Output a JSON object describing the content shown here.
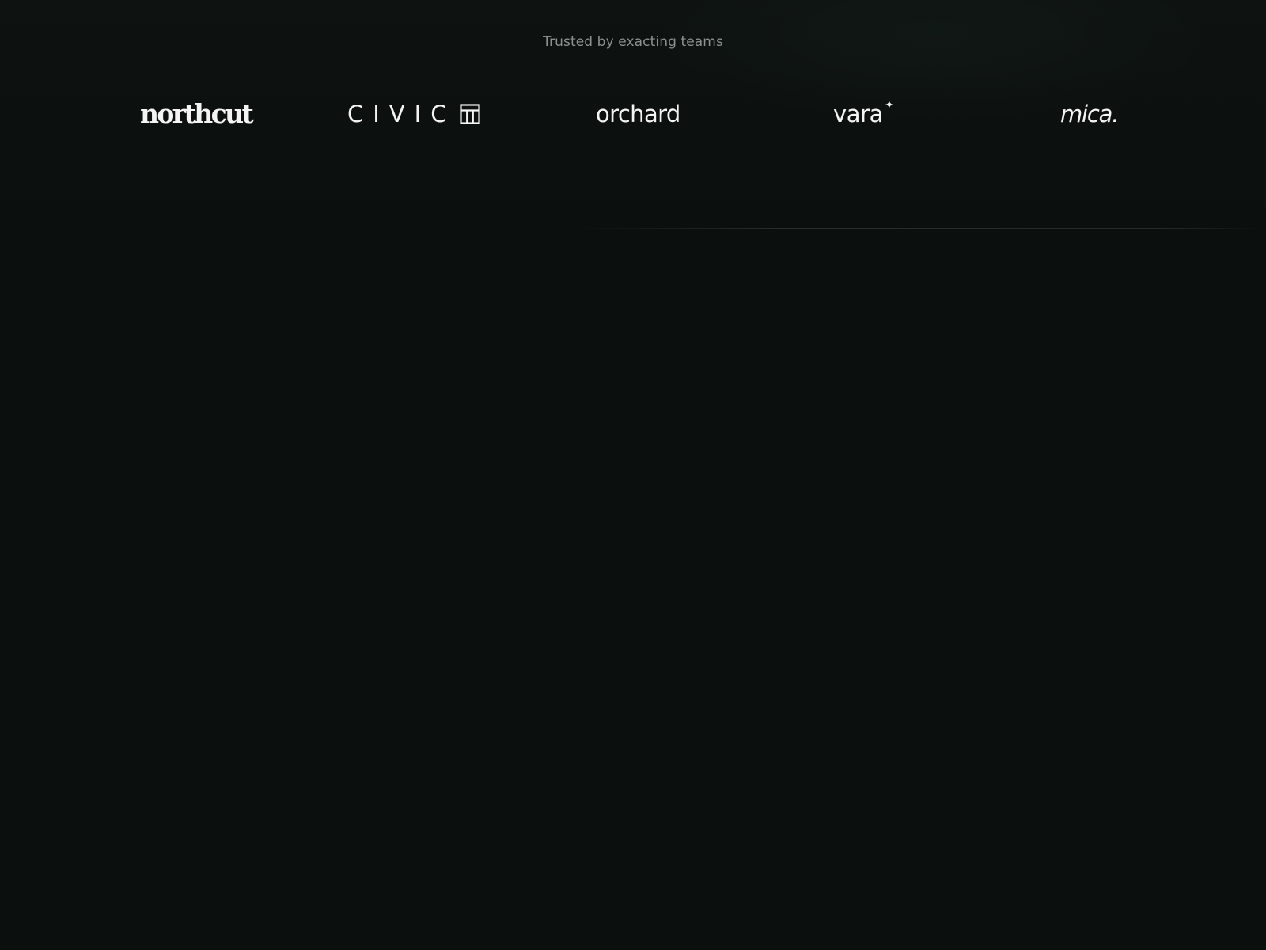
{
  "eyebrow": "Trusted by exacting teams",
  "logos": [
    {
      "name": "northcut",
      "text": "northcut"
    },
    {
      "name": "civic",
      "text": "CIVIC",
      "icon": "building-columns-icon"
    },
    {
      "name": "orchard",
      "text": "orchard"
    },
    {
      "name": "vara",
      "text": "vara",
      "icon": "sparkle-icon"
    },
    {
      "name": "mica",
      "text": "mica."
    }
  ],
  "colors": {
    "background": "#0b0f0e",
    "logo_text": "#f3f4f3",
    "eyebrow_text": "#8d918f"
  }
}
